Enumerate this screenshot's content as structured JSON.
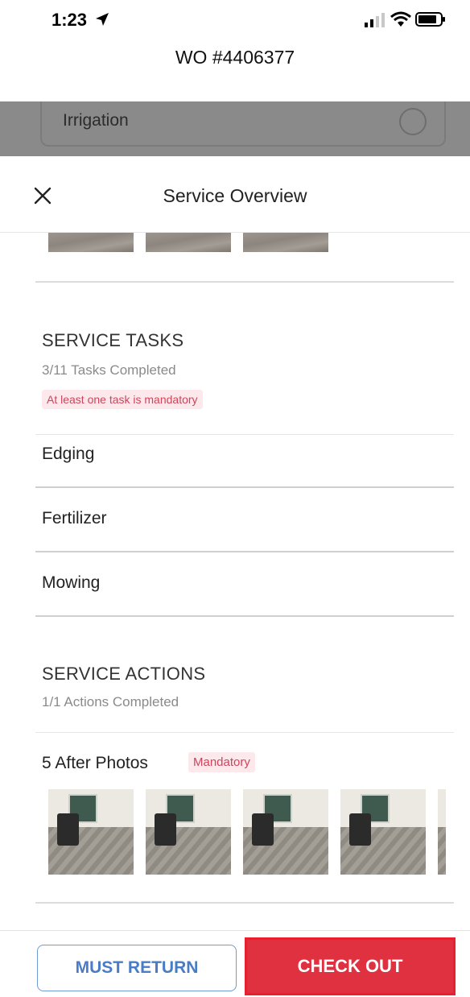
{
  "status_bar": {
    "time": "1:23"
  },
  "header": {
    "title": "WO #4406377"
  },
  "background_card": {
    "label": "Irrigation"
  },
  "sheet": {
    "title": "Service Overview"
  },
  "service_tasks": {
    "heading": "SERVICE TASKS",
    "progress": "3/11 Tasks Completed",
    "warning": "At least one task is mandatory",
    "items": [
      {
        "label": "Edging"
      },
      {
        "label": "Fertilizer"
      },
      {
        "label": "Mowing"
      }
    ]
  },
  "service_actions": {
    "heading": "SERVICE ACTIONS",
    "progress": "1/1 Actions Completed",
    "after_photos": {
      "label": "5 After Photos",
      "badge": "Mandatory",
      "count": 5
    }
  },
  "buttons": {
    "must_return": "MUST RETURN",
    "check_out": "CHECK OUT"
  },
  "colors": {
    "accent_blue": "#4a7cc5",
    "checkout_red": "#e03140",
    "mandatory_bg": "#fde8ec",
    "mandatory_text": "#d0435b"
  }
}
